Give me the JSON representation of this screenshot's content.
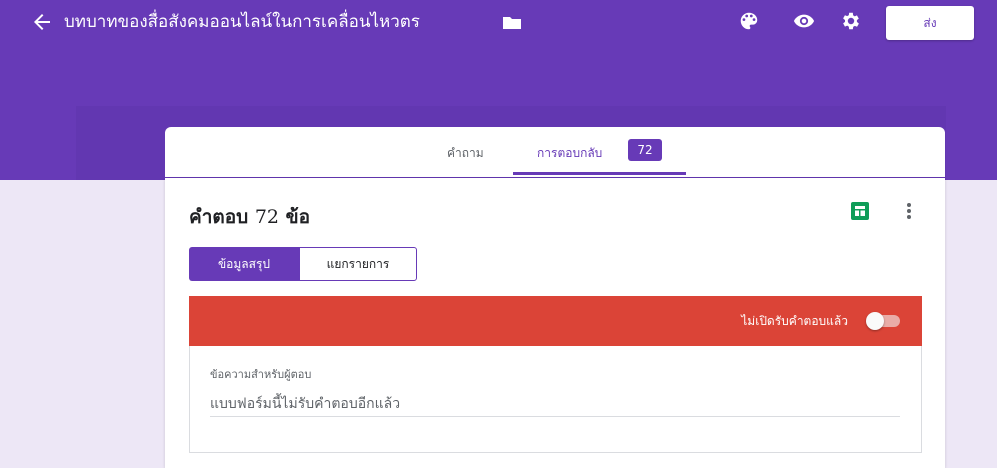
{
  "header": {
    "title": "บทบาทของสื่อสังคมออนไลน์ในการเคลื่อนไหวตร",
    "send_label": "ส่ง",
    "icons": [
      "back-arrow-icon",
      "folder-icon",
      "palette-icon",
      "eye-icon",
      "gear-icon"
    ]
  },
  "tabs": {
    "questions_label": "คำถาม",
    "responses_label": "การตอบกลับ",
    "responses_count": "72"
  },
  "responses": {
    "heading_label": "คำตอบ",
    "heading_count": "72",
    "heading_unit": "ข้อ",
    "summary_label": "ข้อมูลสรุป",
    "individual_label": "แยกรายการ",
    "status_label": "ไม่เปิดรับคำตอบแล้ว",
    "accepting_responses": false,
    "message_label": "ข้อความสำหรับผู้ตอบ",
    "message_value": "แบบฟอร์มนี้ไม่รับคำตอบอีกแล้ว"
  },
  "colors": {
    "primary": "#673ab7",
    "background": "#ede7f6",
    "closed_banner": "#db4437",
    "sheets_green": "#0f9d58"
  }
}
